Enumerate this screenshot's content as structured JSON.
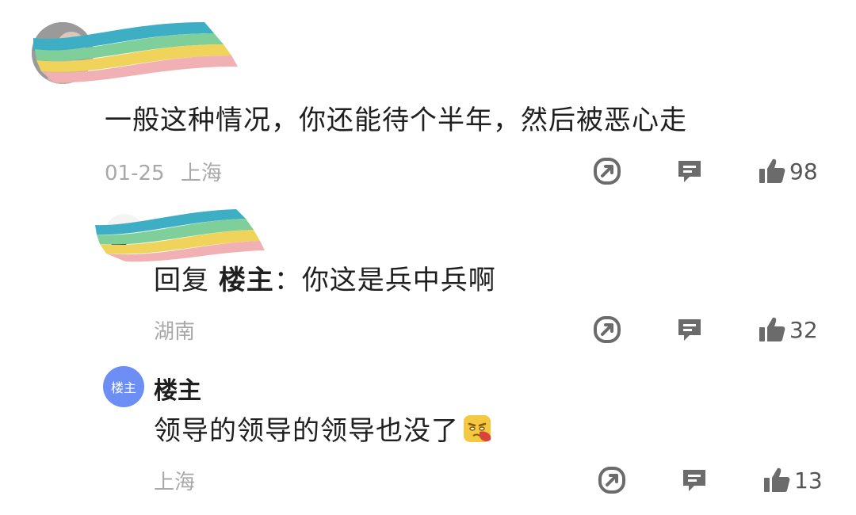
{
  "comments": [
    {
      "text": "一般这种情况，你还能待个半年，然后被恶心走",
      "date": "01-25",
      "location": "上海",
      "likes": "98"
    },
    {
      "reply_prefix": "回复",
      "reply_to": "楼主",
      "separator": "：",
      "text": "你这是兵中兵啊",
      "location": "湖南",
      "likes": "32"
    },
    {
      "avatar_label": "楼主",
      "author": "楼主",
      "text": "领导的领导的领导也没了",
      "emoji": "sad-face-emoji",
      "location": "上海",
      "likes": "13"
    }
  ],
  "icons": {
    "share": "share-icon",
    "reply": "comment-icon",
    "like": "thumbs-up-icon"
  },
  "colors": {
    "avatar_host": "#6c8ef5",
    "meta_text": "#a8a8a8",
    "icon": "#6b6b6b"
  }
}
